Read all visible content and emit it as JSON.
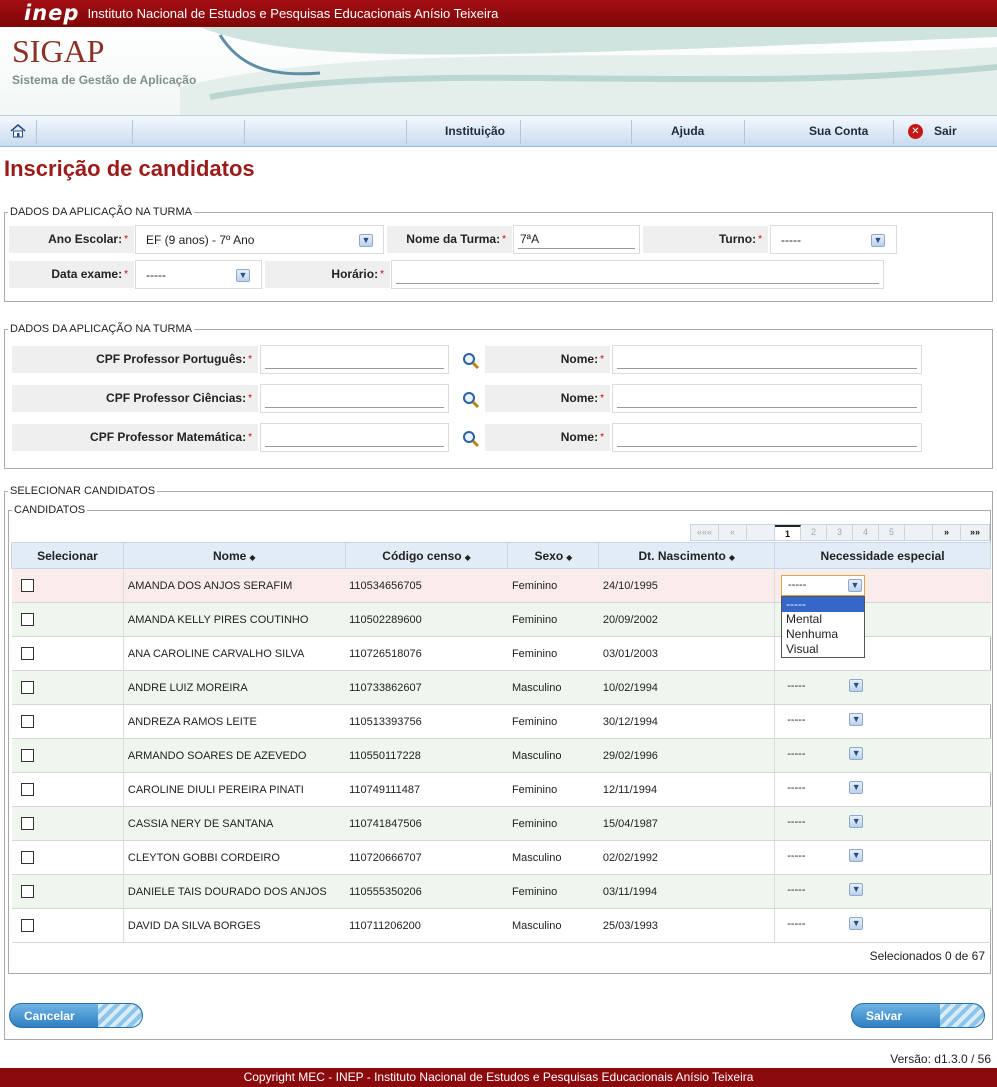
{
  "header": {
    "logo": "inep",
    "institution": "Instituto Nacional de Estudos e Pesquisas Educacionais Anísio Teixeira",
    "app_name": "SIGAP",
    "app_subtitle": "Sistema de Gestão de Aplicação"
  },
  "nav": {
    "home_icon": "home-icon",
    "items": [
      "Instituição",
      "Ajuda",
      "Sua Conta",
      "Sair"
    ]
  },
  "page_title": "Inscrição de candidatos",
  "turma_section": {
    "legend": "DADOS DA APLICAÇÃO NA TURMA",
    "ano_escolar_label": "Ano Escolar:",
    "ano_escolar_value": "EF (9 anos) - 7º Ano",
    "nome_turma_label": "Nome da Turma:",
    "nome_turma_value": "7ªA",
    "turno_label": "Turno:",
    "turno_value": "-----",
    "data_exame_label": "Data exame:",
    "data_exame_value": "-----",
    "horario_label": "Horário:",
    "horario_value": ""
  },
  "professor_section": {
    "legend": "DADOS DA APLICAÇÃO NA TURMA",
    "rows": [
      {
        "cpf_label": "CPF Professor Português:",
        "nome_label": "Nome:"
      },
      {
        "cpf_label": "CPF Professor Ciências:",
        "nome_label": "Nome:"
      },
      {
        "cpf_label": "CPF Professor Matemática:",
        "nome_label": "Nome:"
      }
    ]
  },
  "candidatos": {
    "outer_legend": "SELECIONAR CANDIDATOS",
    "inner_legend": "CANDIDATOS",
    "pager": [
      "«««",
      "«",
      "1",
      "2",
      "3",
      "4",
      "5",
      "»",
      "»»"
    ],
    "columns": [
      "Selecionar",
      "Nome",
      "Código censo",
      "Sexo",
      "Dt. Nascimento",
      "Necessidade especial"
    ],
    "sort_glyph": "◆",
    "rows": [
      {
        "nome": "AMANDA DOS ANJOS SERAFIM",
        "codigo": "110534656705",
        "sexo": "Feminino",
        "nasc": "24/10/1995",
        "nec": "-----"
      },
      {
        "nome": "AMANDA KELLY PIRES COUTINHO",
        "codigo": "110502289600",
        "sexo": "Feminino",
        "nasc": "20/09/2002",
        "nec": "-----"
      },
      {
        "nome": "ANA CAROLINE CARVALHO SILVA",
        "codigo": "110726518076",
        "sexo": "Feminino",
        "nasc": "03/01/2003",
        "nec": "-----"
      },
      {
        "nome": "ANDRE LUIZ MOREIRA",
        "codigo": "110733862607",
        "sexo": "Masculino",
        "nasc": "10/02/1994",
        "nec": "-----"
      },
      {
        "nome": "ANDREZA RAMOS LEITE",
        "codigo": "110513393756",
        "sexo": "Feminino",
        "nasc": "30/12/1994",
        "nec": "-----"
      },
      {
        "nome": "ARMANDO SOARES DE AZEVEDO",
        "codigo": "110550117228",
        "sexo": "Masculino",
        "nasc": "29/02/1996",
        "nec": "-----"
      },
      {
        "nome": "CAROLINE DIULI PEREIRA PINATI",
        "codigo": "110749111487",
        "sexo": "Feminino",
        "nasc": "12/11/1994",
        "nec": "-----"
      },
      {
        "nome": "CASSIA NERY DE SANTANA",
        "codigo": "110741847506",
        "sexo": "Feminino",
        "nasc": "15/04/1987",
        "nec": "-----"
      },
      {
        "nome": "CLEYTON GOBBI CORDEIRO",
        "codigo": "110720666707",
        "sexo": "Masculino",
        "nasc": "02/02/1992",
        "nec": "-----"
      },
      {
        "nome": "DANIELE TAIS DOURADO DOS ANJOS",
        "codigo": "110555350206",
        "sexo": "Feminino",
        "nasc": "03/11/1994",
        "nec": "-----"
      },
      {
        "nome": "DAVID DA SILVA BORGES",
        "codigo": "110711206200",
        "sexo": "Masculino",
        "nasc": "25/03/1993",
        "nec": "-----"
      }
    ],
    "dropdown_options": [
      "-----",
      "Mental",
      "Nenhuma",
      "Visual"
    ],
    "selected_count": "Selecionados 0 de 67"
  },
  "buttons": {
    "cancel": "Cancelar",
    "save": "Salvar"
  },
  "version": "Versão: d1.3.0 / 56",
  "footer": "Copyright MEC - INEP - Instituto Nacional de Estudos e Pesquisas Educacionais Anísio Teixeira",
  "colors": {
    "brand_red": "#8b0a0d",
    "title_red": "#9b1b1b",
    "accent_blue": "#2e7fc4"
  }
}
